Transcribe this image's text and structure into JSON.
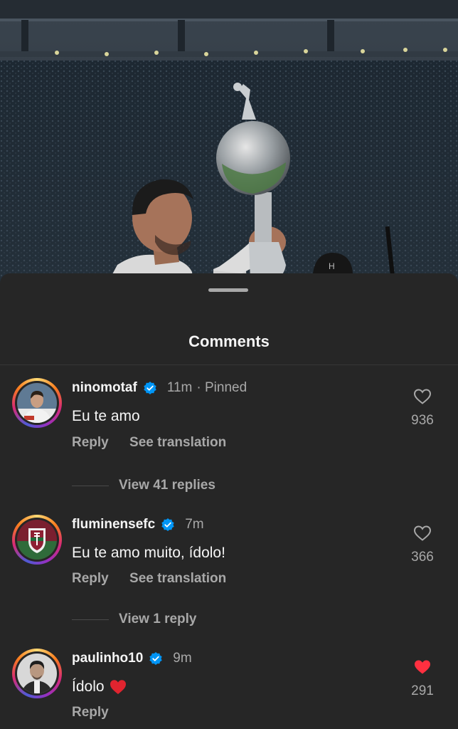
{
  "sheet": {
    "title": "Comments"
  },
  "comments": [
    {
      "username": "ninomotaf",
      "time": "11m",
      "pinned": "· Pinned",
      "text": "Eu te amo",
      "reply": "Reply",
      "translate": "See translation",
      "likes": "936",
      "liked": false,
      "view_replies": "View 41 replies"
    },
    {
      "username": "fluminensefc",
      "time": "7m",
      "text": "Eu te amo muito, ídolo!",
      "reply": "Reply",
      "translate": "See translation",
      "likes": "366",
      "liked": false,
      "view_replies": "View 1 reply"
    },
    {
      "username": "paulinho10",
      "time": "9m",
      "text": "Ídolo",
      "emoji": "❤️",
      "reply": "Reply",
      "likes": "291",
      "liked": true
    }
  ],
  "colors": {
    "sheet_bg": "#262626",
    "secondary_text": "#a8a8a8",
    "verified_blue": "#0095f6",
    "like_red": "#ff3040"
  }
}
